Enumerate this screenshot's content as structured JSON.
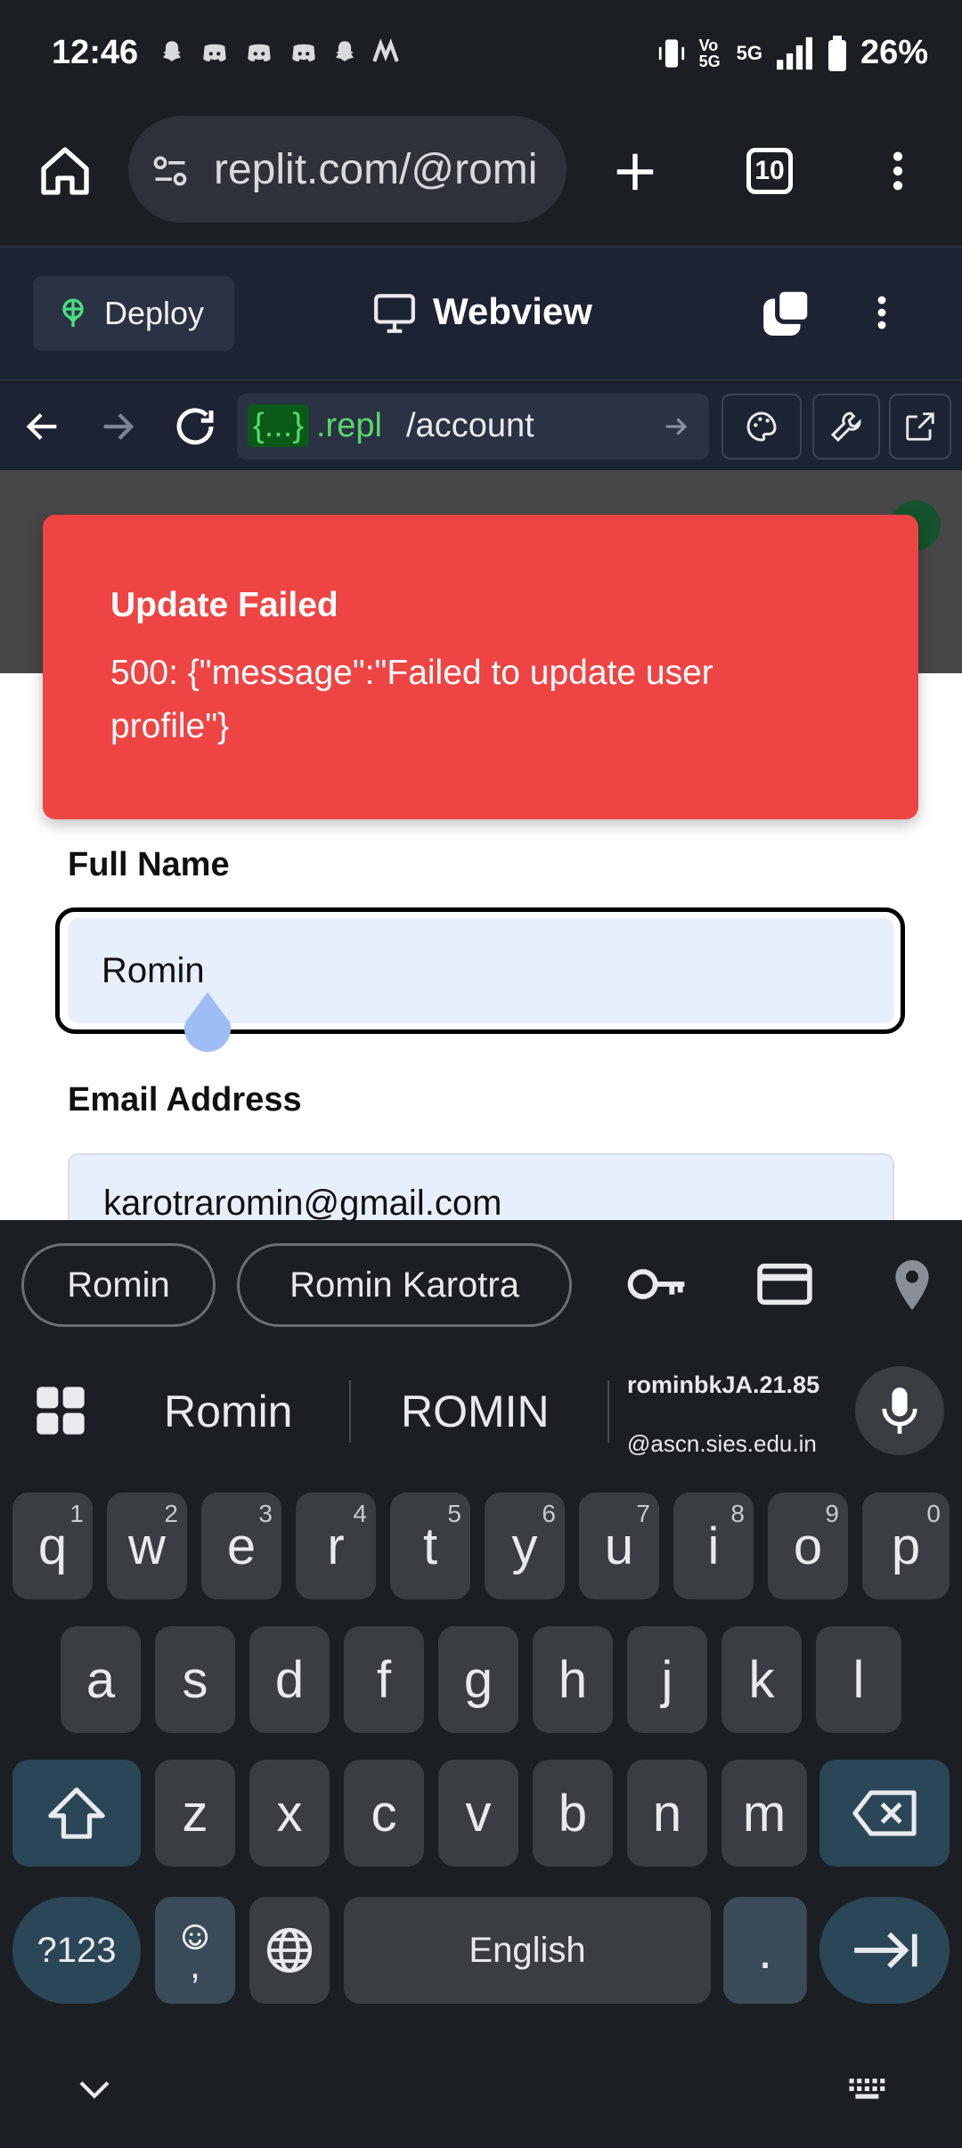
{
  "status_bar": {
    "time": "12:46",
    "battery": "26%",
    "network": "5G",
    "volte": "Vo 5G"
  },
  "browser": {
    "url": "replit.com/@romi",
    "tab_count": "10"
  },
  "replit": {
    "deploy_label": "Deploy",
    "webview_label": "Webview",
    "address_prefix": "{...}",
    "address_repl": ".repl",
    "address_path": "/account"
  },
  "toast": {
    "title": "Update Failed",
    "message": "500: {\"message\":\"Failed to update user profile\"}"
  },
  "form": {
    "full_name_label": "Full Name",
    "full_name_value": "Romin",
    "email_label": "Email Address",
    "email_value": "karotraromin@gmail.com"
  },
  "autofill": {
    "chips": [
      "Romin",
      "Romin Karotra"
    ]
  },
  "keyboard": {
    "suggestions": [
      "Romin",
      "ROMIN"
    ],
    "email_suggestion_line1": "rominbkJA.21.85",
    "email_suggestion_line2": "@ascn.sies.edu.in",
    "row1": [
      "q",
      "w",
      "e",
      "r",
      "t",
      "y",
      "u",
      "i",
      "o",
      "p"
    ],
    "row1_sup": [
      "1",
      "2",
      "3",
      "4",
      "5",
      "6",
      "7",
      "8",
      "9",
      "0"
    ],
    "row2": [
      "a",
      "s",
      "d",
      "f",
      "g",
      "h",
      "j",
      "k",
      "l"
    ],
    "row3": [
      "z",
      "x",
      "c",
      "v",
      "b",
      "n",
      "m"
    ],
    "symbols_key": "?123",
    "comma_key": ",",
    "space_label": "English",
    "period_key": "."
  },
  "colors": {
    "toast_bg": "#ef4444",
    "field_bg": "#e8effc",
    "replit_header_bg": "#1d2333",
    "keyboard_bg": "#1b1e22"
  }
}
